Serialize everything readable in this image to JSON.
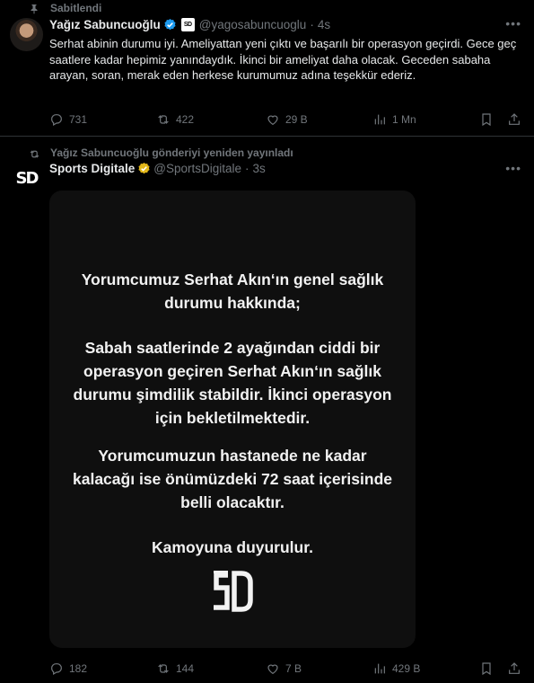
{
  "tweet1": {
    "pinned_label": "Sabitlendi",
    "name": "Yağız Sabuncuoğlu",
    "org_badge_text": "SD",
    "handle": "@yagosabuncuoglu",
    "separator": "·",
    "time": "4s",
    "text": "Serhat abinin durumu iyi. Ameliyattan yeni çıktı ve başarılı bir operasyon geçirdi. Gece geç saatlere kadar hepimiz yanındaydık. İkinci bir ameliyat daha olacak. Geceden sabaha arayan, soran, merak eden herkese kurumumuz adına teşekkür ederiz.",
    "replies": "731",
    "reposts": "422",
    "likes": "29 B",
    "views": "1 Mn"
  },
  "tweet2": {
    "repost_label": "Yağız Sabuncuoğlu gönderiyi yeniden yayınladı",
    "name": "Sports Digitale",
    "handle": "@SportsDigitale",
    "separator": "·",
    "time": "3s",
    "logo_text": "SD",
    "media": {
      "para1": "Yorumcumuz Serhat Akın‘ın genel sağlık durumu hakkında;",
      "para2": "Sabah saatlerinde 2 ayağından ciddi bir operasyon geçiren Serhat Akın‘ın sağlık durumu şimdilik stabildir. İkinci operasyon için bekletilmektedir.",
      "para3": "Yorumcumuzun hastanede ne kadar kalacağı ise önümüzdeki 72 saat içerisinde belli olacaktır.",
      "para4": "Kamoyuna duyurulur.",
      "logo_text": "SD"
    },
    "replies": "182",
    "reposts": "144",
    "likes": "7 B",
    "views": "429 B"
  },
  "colors": {
    "background": "#000000",
    "text": "#e7e9ea",
    "muted": "#71767b",
    "verified_blue": "#1d9bf0",
    "verified_gold": "#e2b719",
    "media_bg": "#0f0f0f"
  },
  "icons": {
    "pin": "pin-icon",
    "repost": "repost-icon",
    "reply": "reply-icon",
    "like": "heart-icon",
    "views": "views-icon",
    "bookmark": "bookmark-icon",
    "share": "share-icon",
    "more": "more-icon",
    "verified": "verified-badge-icon"
  }
}
